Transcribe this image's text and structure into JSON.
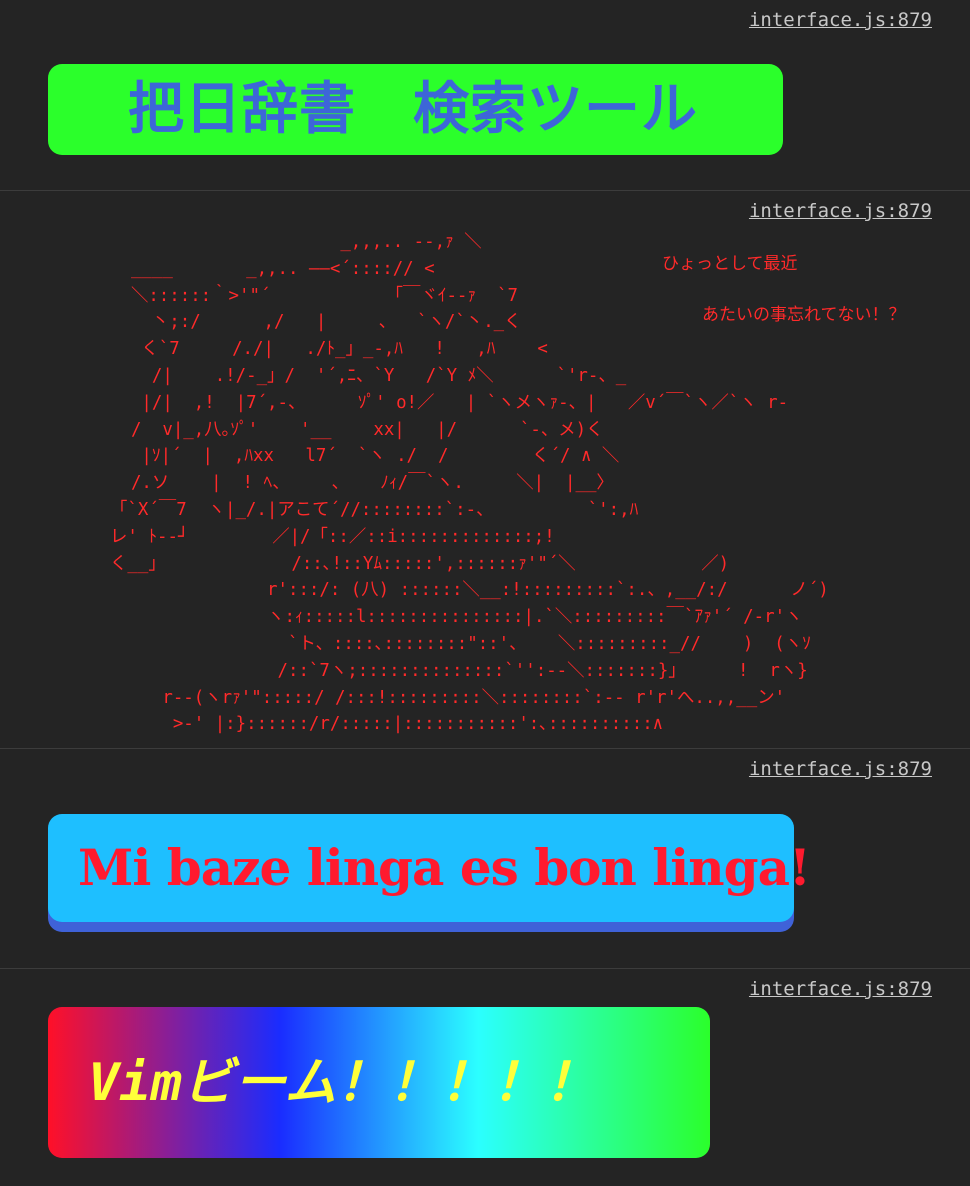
{
  "source_link": "interface.js:879",
  "entries": [
    {
      "title": "把日辞書　検索ツール",
      "colors": {
        "background": "#2bff2b",
        "text": "#3d66d8"
      }
    },
    {
      "ascii_art": "                      _,,,.. --,ｧ ＼\n  ____       _,,.. ――<´::::// <\n  ＼::::::｀>'\"´           「￣ヾｲ--ｧ  `7\n    丶;:/      ,/   |     、  `ヽ/`丶._く\n   く`7     /./|   ./ﾄ_」_-,ﾊ   !   ,ﾊ    <\n    /|    .!/-_」/  '´,ﾆ、`Y   /`Y ﾒ＼      `'r-、_\n   |/|  ,!  |7´,-、     ｿﾟ' o!／   | `ヽメヽｧ-、|   ／v´￣`ヽ／`ヽ r-\n  /  v|_,八｡ｿﾟ'    '__    xx|   |/      `-、メ)く\n   |ｿ|´  |  ,ﾊxx   l7´  `ヽ ./  /        く´/ ∧ ＼\n  /.ソ    |  ! ﾍ、    、   ﾉｨ/￣`ヽ.     ＼|  |__〉\n「`X´￣7  ヽ|_/.|アこて´//::::::::`:-、         `':,ﾊ\nレ' ﾄ--┘        ／|/「::／::i:::::::::::::;!\nく__」            /::､!::Yﾑ:::::',::::::ｧ'\"´＼            ／)\n               r':::/: (八) ::::::＼__:!:::::::::`:.、,__/:/      ノ´)\n               ヽ:ｨ:::::l:::::::::::::::|.`＼:::::::::￣`ｱｧ'´ /-r'ヽ\n                 `ト、::::､::::::::\"::'、   ＼:::::::::_//    )  (ヽｿ\n                /::`7ヽ;::::::::::::::`'':--＼:::::::}」     !  rヽ}\n     r--(ヽrｧ'\":::::/ /:::!:::::::::＼::::::::`:-- r'r'へ..,,__ン'\n      >-' |:}::::::/r/:::::|:::::::::::':､::::::::::∧",
      "notes": [
        "ひょっとして最近",
        "あたいの事忘れてない！？"
      ],
      "colors": {
        "text": "#ff2a2a"
      }
    },
    {
      "message": "Mi baze linga es bon linga!",
      "colors": {
        "background": "#1ebfff",
        "shadow": "#3f62d8",
        "text": "#ff1a2e"
      }
    },
    {
      "message": "Vimビーム！！！！！",
      "colors": {
        "gradient": [
          "#ff1028",
          "#1a2cff",
          "#2bffff",
          "#2bff2b"
        ],
        "text": "#ffff3a"
      }
    }
  ]
}
